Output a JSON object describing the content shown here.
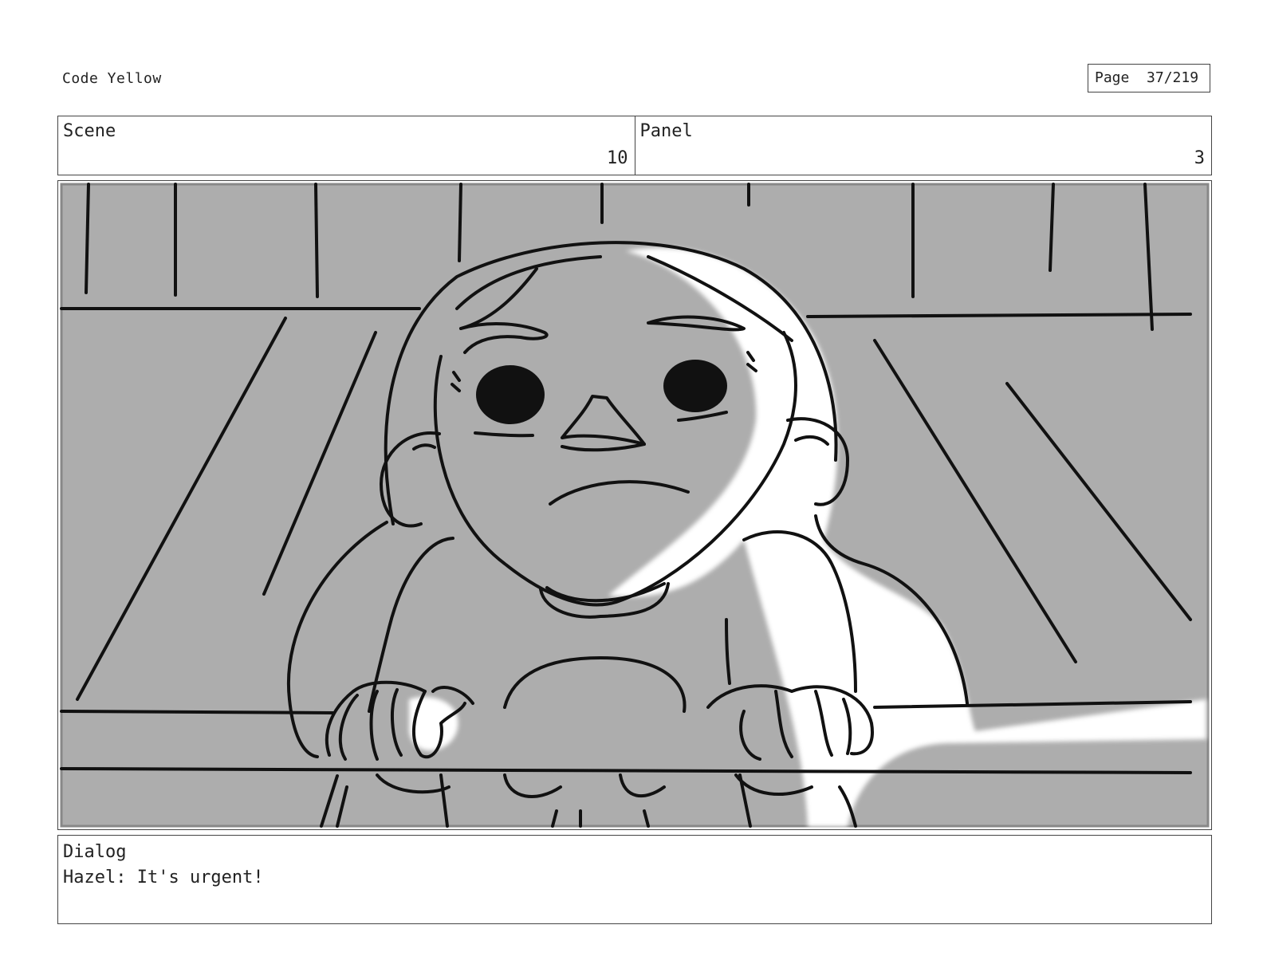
{
  "header": {
    "title": "Code Yellow",
    "page_label": "Page",
    "page_value": "37/219"
  },
  "scene": {
    "label": "Scene",
    "value": "10"
  },
  "panel": {
    "label": "Panel",
    "value": "3"
  },
  "dialog": {
    "label": "Dialog",
    "text": "Hazel: It's urgent!"
  },
  "colors": {
    "frame_fill": "#adadad",
    "ink": "#111111",
    "highlight": "#ffffff"
  }
}
